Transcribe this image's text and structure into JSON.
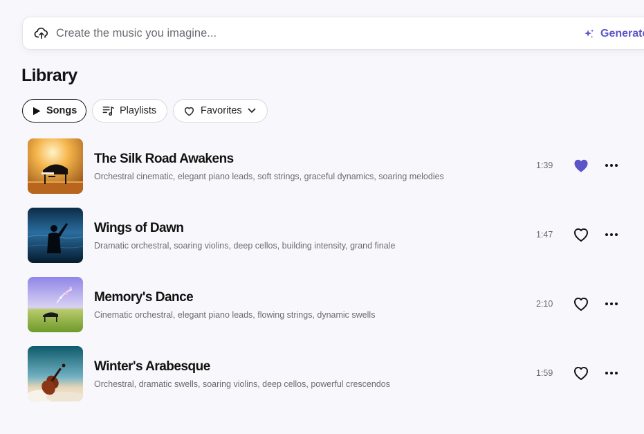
{
  "prompt_bar": {
    "placeholder": "Create the music you imagine...",
    "value": "",
    "upload_icon": "upload-cloud-icon",
    "generate_label": "Generate",
    "generate_icon": "sparkles-icon"
  },
  "page_title": "Library",
  "filters": [
    {
      "label": "Songs",
      "icon": "play-icon",
      "active": true
    },
    {
      "label": "Playlists",
      "icon": "playlist-icon",
      "active": false
    },
    {
      "label": "Favorites",
      "icon": "heart-icon",
      "active": false,
      "dropdown_icon": "chevron-down-icon"
    }
  ],
  "songs": [
    {
      "title": "The Silk Road Awakens",
      "tags": "Orchestral cinematic, elegant piano leads, soft strings, graceful dynamics, soaring melodies",
      "duration": "1:39",
      "liked": true,
      "cover": "grand piano on a sunlit stage"
    },
    {
      "title": "Wings of Dawn",
      "tags": "Dramatic orchestral, soaring violins, deep cellos, building intensity, grand finale",
      "duration": "1:47",
      "liked": false,
      "cover": "silhouette of a conductor over the sea"
    },
    {
      "title": "Memory's Dance",
      "tags": "Cinematic orchestral, elegant piano leads, flowing strings, dynamic swells",
      "duration": "2:10",
      "liked": false,
      "cover": "piano in a green meadow under a violet sky"
    },
    {
      "title": "Winter's Arabesque",
      "tags": "Orchestral, dramatic swells, soaring violins, deep cellos, powerful crescendos",
      "duration": "1:59",
      "liked": false,
      "cover": "violin floating above clouds"
    }
  ],
  "colors": {
    "accent": "#5b55c8",
    "liked": "#5b55c8",
    "background": "#f8f8fc"
  }
}
